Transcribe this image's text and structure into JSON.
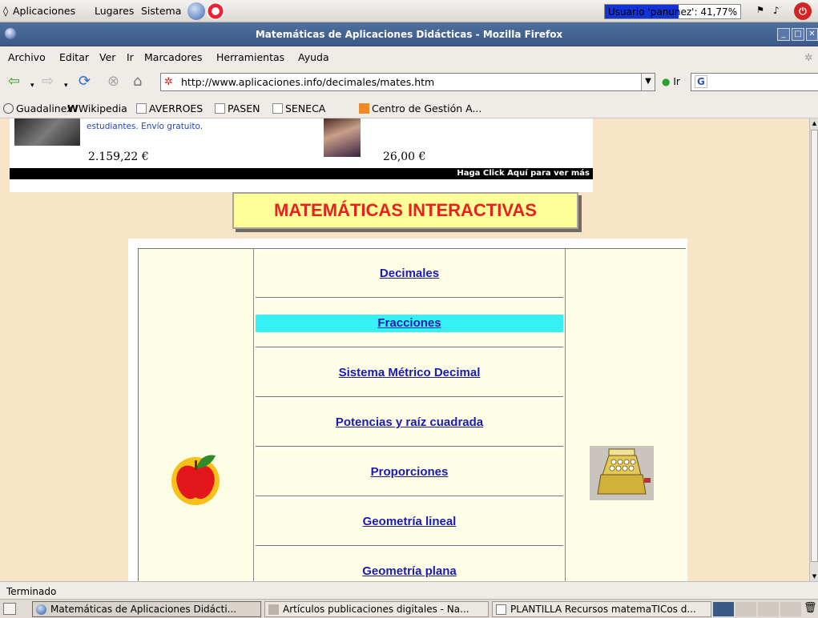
{
  "gnome_panel": {
    "menus": [
      "Aplicaciones",
      "Lugares",
      "Sistema"
    ],
    "user_status": "Usuario 'panunez': 41,77%"
  },
  "window": {
    "title": "Matemáticas de Aplicaciones Didácticas - Mozilla Firefox"
  },
  "menubar": [
    "Archivo",
    "Editar",
    "Ver",
    "Ir",
    "Marcadores",
    "Herramientas",
    "Ayuda"
  ],
  "toolbar": {
    "url": "http://www.aplicaciones.info/decimales/mates.htm",
    "go_label": "Ir"
  },
  "bookmarks": [
    "Guadalinex",
    "Wikipedia",
    "AVERROES",
    "PASEN",
    "SENECA",
    "Centro de Gestión A..."
  ],
  "ad": {
    "description": "estudiantes. Envío gratuito.",
    "price1": "2.159,22 €",
    "price2": "26,00 €",
    "cta": "Haga Click Aquí para ver más"
  },
  "page": {
    "title": "MATEMÁTICAS INTERACTIVAS",
    "menu": [
      "Decimales",
      "Fracciones",
      "Sistema Métrico Decimal",
      "Potencias y raíz cuadrada",
      "Proporciones",
      "Geometría lineal",
      "Geometría plana"
    ]
  },
  "status": "Terminado",
  "taskbar": [
    "Matemáticas de Aplicaciones Didácti...",
    "Artículos publicaciones digitales - Na...",
    "PLANTILLA Recursos matemaTICos d..."
  ],
  "colors": {
    "page_bg": "#f8e4c6",
    "banner_bg": "#ffff99",
    "banner_text": "#e8201f",
    "link": "#1a1ab4",
    "highlight": "#35f0f5",
    "titlebar": "#3a5987"
  }
}
